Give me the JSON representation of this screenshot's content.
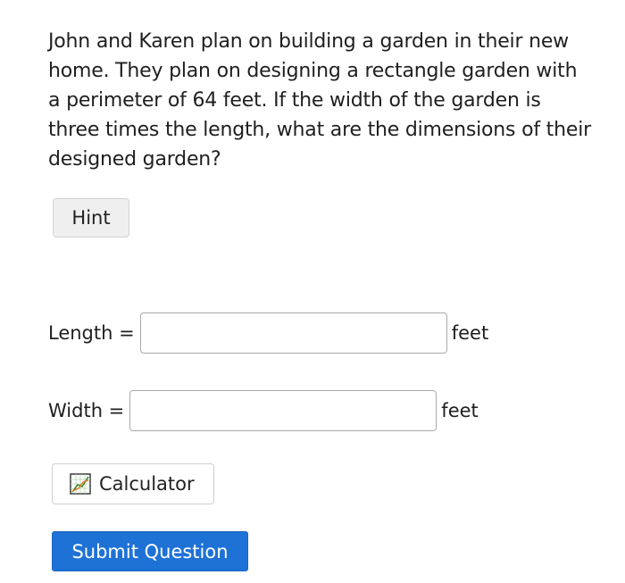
{
  "question": {
    "text": "John and Karen plan on building a garden in their new home. They plan on designing a rectangle garden with a perimeter of 64 feet. If the width of the garden is three times the length, what are the dimensions of their designed garden?"
  },
  "hint_button": {
    "label": "Hint"
  },
  "answers": {
    "length": {
      "label": "Length =",
      "value": "",
      "unit": "feet"
    },
    "width": {
      "label": "Width =",
      "value": "",
      "unit": "feet"
    }
  },
  "calculator_button": {
    "label": "Calculator",
    "icon": "graph-paper-icon"
  },
  "submit_button": {
    "label": "Submit Question"
  },
  "colors": {
    "submit_bg": "#1e72d6",
    "submit_text": "#ffffff",
    "hint_bg": "#efefef",
    "input_border": "#a9a9a9"
  }
}
